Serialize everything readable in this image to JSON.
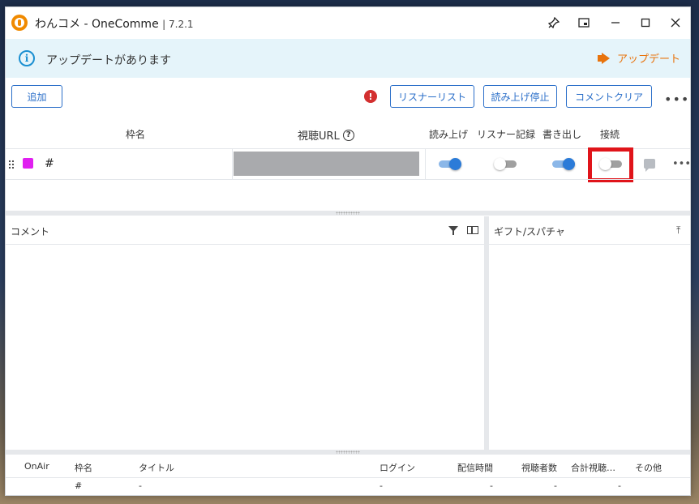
{
  "window": {
    "title": "わんコメ - OneComme",
    "version": "7.2.1"
  },
  "titlebar_controls": [
    "pin-icon",
    "picture-in-picture-icon",
    "minimize-icon",
    "maximize-icon",
    "close-icon"
  ],
  "banner": {
    "text": "アップデートがあります",
    "link_label": "アップデート",
    "accent": "#e8730c"
  },
  "toolbar": {
    "add_label": "追加",
    "listener_list_label": "リスナーリスト",
    "stop_reading_label": "読み上げ停止",
    "clear_comments_label": "コメントクリア",
    "more_label": "•••"
  },
  "frame_table": {
    "headers": {
      "name": "枠名",
      "url": "視聴URL",
      "read": "読み上げ",
      "listener_log": "リスナー記録",
      "export": "書き出し",
      "connect": "接続"
    },
    "row": {
      "name": "#",
      "color": "#e020f0",
      "read_on": true,
      "listener_log_on": false,
      "export_on": true,
      "connect_on": false
    }
  },
  "comment_pane": {
    "title": "コメント"
  },
  "gift_pane": {
    "title": "ギフト/スパチャ"
  },
  "bottom_table": {
    "headers": [
      "OnAir",
      "枠名",
      "タイトル",
      "ログイン",
      "配信時間",
      "視聴者数",
      "合計視聴…",
      "その他"
    ],
    "row": [
      "",
      "#",
      "-",
      "-",
      "-",
      "-",
      "-",
      ""
    ]
  }
}
